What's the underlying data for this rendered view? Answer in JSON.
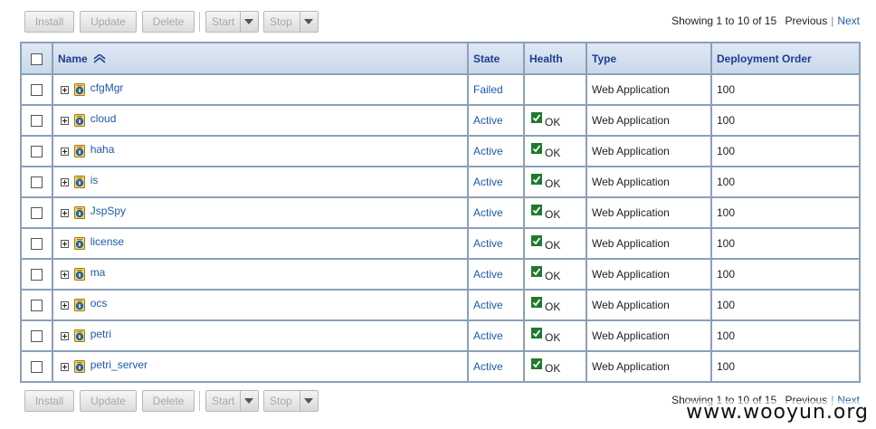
{
  "toolbar": {
    "install": "Install",
    "update": "Update",
    "delete": "Delete",
    "start": "Start",
    "stop": "Stop"
  },
  "pager": {
    "showing": "Showing 1 to 10 of 15",
    "previous": "Previous",
    "separator": "|",
    "next": "Next"
  },
  "table": {
    "columns": {
      "name": "Name",
      "state": "State",
      "health": "Health",
      "type": "Type",
      "order": "Deployment Order"
    },
    "rows": [
      {
        "name": "cfgMgr",
        "state": "Failed",
        "health": "",
        "type": "Web Application",
        "order": "100"
      },
      {
        "name": "cloud",
        "state": "Active",
        "health": "OK",
        "type": "Web Application",
        "order": "100"
      },
      {
        "name": "haha",
        "state": "Active",
        "health": "OK",
        "type": "Web Application",
        "order": "100"
      },
      {
        "name": "is",
        "state": "Active",
        "health": "OK",
        "type": "Web Application",
        "order": "100"
      },
      {
        "name": "JspSpy",
        "state": "Active",
        "health": "OK",
        "type": "Web Application",
        "order": "100"
      },
      {
        "name": "license",
        "state": "Active",
        "health": "OK",
        "type": "Web Application",
        "order": "100"
      },
      {
        "name": "ma",
        "state": "Active",
        "health": "OK",
        "type": "Web Application",
        "order": "100"
      },
      {
        "name": "ocs",
        "state": "Active",
        "health": "OK",
        "type": "Web Application",
        "order": "100"
      },
      {
        "name": "petri",
        "state": "Active",
        "health": "OK",
        "type": "Web Application",
        "order": "100"
      },
      {
        "name": "petri_server",
        "state": "Active",
        "health": "OK",
        "type": "Web Application",
        "order": "100"
      }
    ]
  },
  "watermark": "www.wooyun.org",
  "icons": {
    "sort": "sort-ascending-icon",
    "expand": "plus-box-icon",
    "app": "web-app-icon",
    "health_ok": "green-check-icon",
    "dropdown": "chevron-down-icon"
  },
  "colors": {
    "header_text": "#1a3f8f",
    "link": "#1e5aa8",
    "grid_border": "#8aa0ba",
    "ok_green": "#1f7a2e"
  }
}
